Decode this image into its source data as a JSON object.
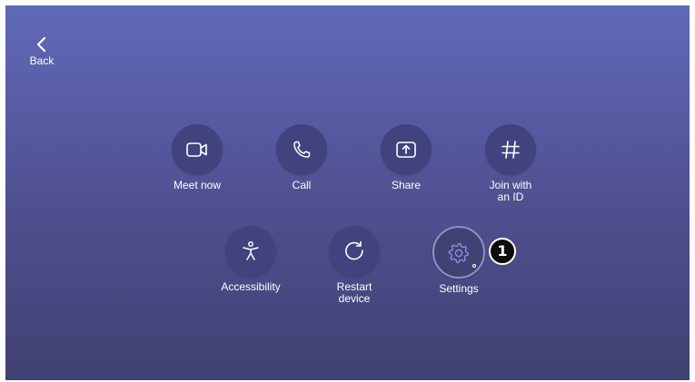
{
  "back": {
    "label": "Back",
    "icon": "chevron-left-icon"
  },
  "tiles_row1": [
    {
      "label": "Meet now",
      "icon": "video-camera-icon"
    },
    {
      "label": "Call",
      "icon": "phone-icon"
    },
    {
      "label": "Share",
      "icon": "share-screen-icon"
    },
    {
      "label": "Join with\nan ID",
      "icon": "hash-icon"
    }
  ],
  "tiles_row2": [
    {
      "label": "Accessibility",
      "icon": "accessibility-icon"
    },
    {
      "label": "Restart\ndevice",
      "icon": "restart-icon"
    },
    {
      "label": "Settings",
      "icon": "gear-icon"
    }
  ],
  "callout": {
    "number": "1"
  },
  "colors": {
    "background_top": "#6169b9",
    "background_bottom": "#414173",
    "tile_circle": "#40437d",
    "text": "#ffffff"
  }
}
